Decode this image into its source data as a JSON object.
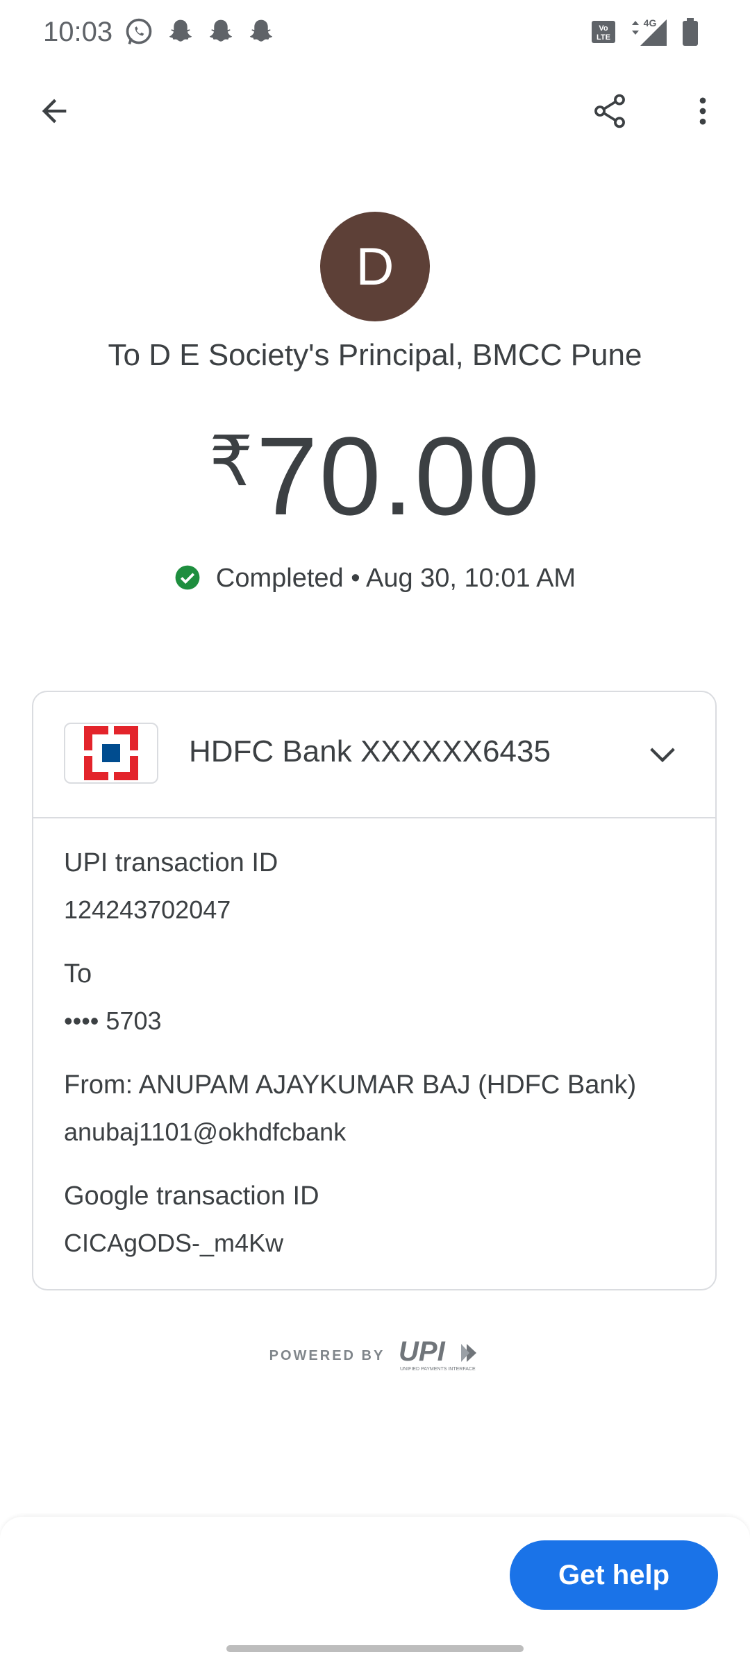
{
  "status_bar": {
    "time": "10:03",
    "network": "4G",
    "notification_icons": [
      "whatsapp-icon",
      "snapchat-icon",
      "snapchat-icon",
      "snapchat-icon"
    ]
  },
  "app_bar": {
    "back_icon": "arrow-back-icon",
    "share_icon": "share-icon",
    "more_icon": "more-vert-icon"
  },
  "payee": {
    "avatar_initial": "D",
    "avatar_color": "#5d4037",
    "name": "To D E Society's Principal, BMCC Pune"
  },
  "amount": {
    "currency": "₹",
    "value": "70.00"
  },
  "status": {
    "icon": "check-circle-icon",
    "icon_color": "#1e8e3e",
    "text": "Completed • Aug 30, 10:01 AM"
  },
  "account_card": {
    "bank_name": "HDFC Bank XXXXXX6435",
    "details": [
      {
        "label": "UPI transaction ID",
        "value": "124243702047"
      },
      {
        "label": "To",
        "value": "•••• 5703"
      },
      {
        "label": "From: ANUPAM AJAYKUMAR BAJ (HDFC Bank)",
        "value": "anubaj1101@okhdfcbank"
      },
      {
        "label": "Google transaction ID",
        "value": "CICAgODS-_m4Kw"
      }
    ]
  },
  "footer": {
    "powered_by": "POWERED BY",
    "upi_logo_text": "UPI",
    "upi_tagline": "UNIFIED PAYMENTS INTERFACE"
  },
  "actions": {
    "help_label": "Get help",
    "accent_color": "#1a73e8"
  }
}
